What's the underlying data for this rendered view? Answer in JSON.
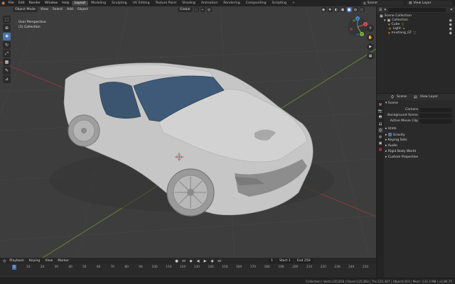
{
  "topbar": {
    "menus": [
      "File",
      "Edit",
      "Render",
      "Window",
      "Help"
    ],
    "workspaces": [
      "Layout",
      "Modeling",
      "Sculpting",
      "UV Editing",
      "Texture Paint",
      "Shading",
      "Animation",
      "Rendering",
      "Compositing",
      "Scripting",
      "+"
    ],
    "active_workspace": "Layout",
    "scene_name": "Scene",
    "view_layer_name": "View Layer"
  },
  "viewport": {
    "mode": "Object Mode",
    "menus": [
      "View",
      "Select",
      "Add",
      "Object"
    ],
    "orientation": "Global",
    "view_name": "User Perspective",
    "collection_label": "(1) Collection",
    "gizmo": {
      "x": "X",
      "y": "Y",
      "z": "Z"
    }
  },
  "outliner": {
    "items": [
      {
        "label": "Scene Collection",
        "icon": "scene-collection-icon",
        "depth": 0
      },
      {
        "label": "Collection",
        "icon": "collection-icon",
        "depth": 1
      },
      {
        "label": "Cube",
        "icon": "object-icon",
        "depth": 2,
        "color": "#f0a040"
      },
      {
        "label": "Light",
        "icon": "light-icon",
        "depth": 2,
        "color": "#f0a040"
      },
      {
        "label": "mustang_GT",
        "icon": "object-icon",
        "depth": 2,
        "color": "#f0a040"
      }
    ]
  },
  "properties": {
    "tabs": [
      "Scene",
      "View Layer"
    ],
    "section_title": "Scene",
    "fields": [
      {
        "label": "Camera"
      },
      {
        "label": "Background Scene"
      },
      {
        "label": "Active Movie Clip"
      }
    ],
    "panels": [
      "Units",
      "Gravity",
      "Keying Sets",
      "Audio",
      "Rigid Body World",
      "Custom Properties"
    ]
  },
  "timeline": {
    "menus": [
      "Playback",
      "Keying",
      "View",
      "Marker"
    ],
    "current_frame": "1",
    "start_label": "Start",
    "start": "1",
    "end_label": "End",
    "end": "250",
    "ruler": [
      "0",
      "10",
      "20",
      "30",
      "40",
      "50",
      "60",
      "70",
      "80",
      "90",
      "100",
      "110",
      "120",
      "130",
      "140",
      "150",
      "160",
      "170",
      "180",
      "190",
      "200",
      "210",
      "220",
      "230",
      "240",
      "250"
    ]
  },
  "statusbar": {
    "text": "Collection | Verts:135,816 | Faces:125,363 | Tris:125,367 | Objects:0/3 | Mem: 133.3 MB | v2.80.75"
  },
  "colors": {
    "accent": "#4772b3",
    "object_orange": "#f0a040",
    "viewport_bg": "#3d3d3d",
    "car_body": "#c8c8c8",
    "glass": "#3e5a78"
  }
}
